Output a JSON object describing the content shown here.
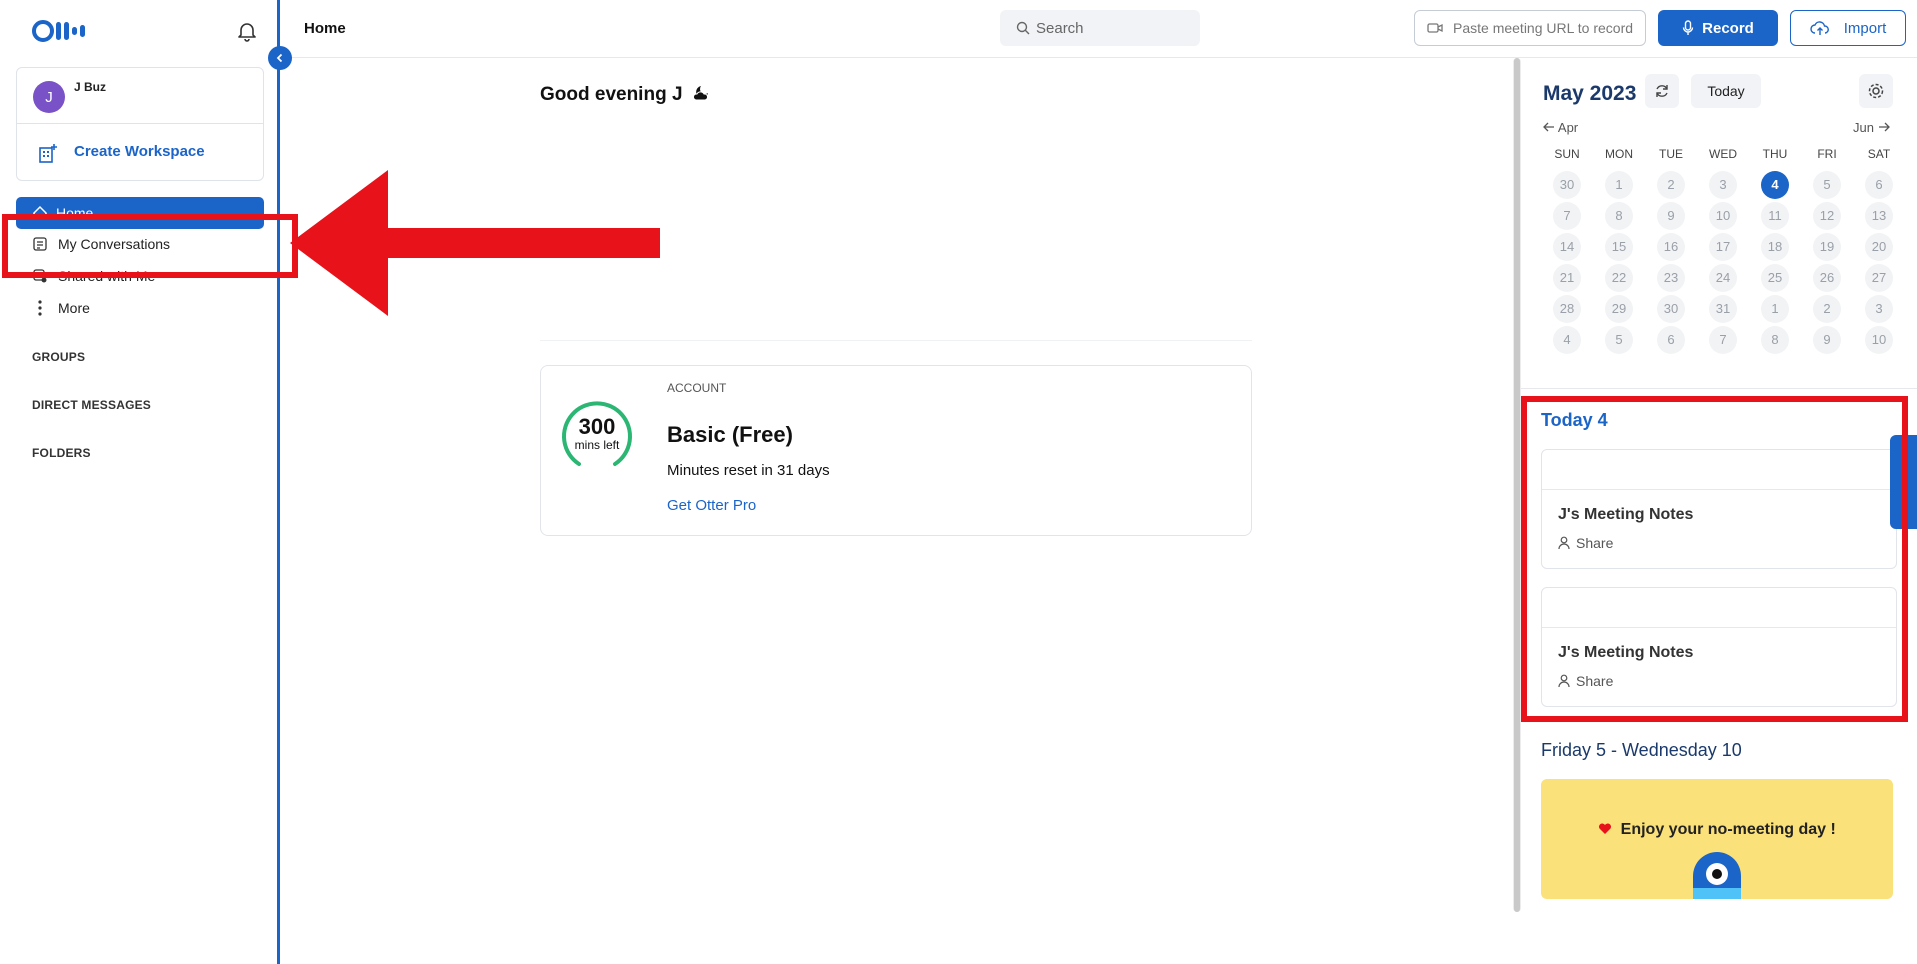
{
  "header": {
    "title": "Home",
    "search_placeholder": "Search",
    "paste_placeholder": "Paste meeting URL to record",
    "record_label": "Record",
    "import_label": "Import"
  },
  "sidebar": {
    "user_initial": "J",
    "user_name": "J Buz",
    "create_workspace": "Create Workspace",
    "nav": {
      "home": "Home",
      "conversations": "My Conversations",
      "shared": "Shared with Me",
      "more": "More"
    },
    "sections": {
      "groups": "GROUPS",
      "direct_messages": "DIRECT MESSAGES",
      "folders": "FOLDERS"
    }
  },
  "main": {
    "greeting": "Good evening J",
    "account": {
      "label": "ACCOUNT",
      "minutes": "300",
      "minutes_sub": "mins left",
      "plan": "Basic (Free)",
      "reset": "Minutes reset in 31 days",
      "upgrade_link": "Get Otter Pro"
    }
  },
  "calendar": {
    "month": "May 2023",
    "today_label": "Today",
    "prev": "Apr",
    "next": "Jun",
    "dow": [
      "SUN",
      "MON",
      "TUE",
      "WED",
      "THU",
      "FRI",
      "SAT"
    ],
    "weeks": [
      [
        "30",
        "1",
        "2",
        "3",
        "4",
        "5",
        "6"
      ],
      [
        "7",
        "8",
        "9",
        "10",
        "11",
        "12",
        "13"
      ],
      [
        "14",
        "15",
        "16",
        "17",
        "18",
        "19",
        "20"
      ],
      [
        "21",
        "22",
        "23",
        "24",
        "25",
        "26",
        "27"
      ],
      [
        "28",
        "29",
        "30",
        "31",
        "1",
        "2",
        "3"
      ],
      [
        "4",
        "5",
        "6",
        "7",
        "8",
        "9",
        "10"
      ]
    ],
    "selected_day": "4"
  },
  "agenda": {
    "today_heading": "Today 4",
    "meetings": [
      {
        "title": "J's Meeting Notes",
        "share": "Share"
      },
      {
        "title": "J's Meeting Notes",
        "share": "Share"
      }
    ],
    "range_heading": "Friday 5 - Wednesday 10",
    "no_meeting": "Enjoy your no-meeting day !"
  },
  "colors": {
    "brand": "#1b64c8",
    "annotation": "#e8121a",
    "no_meeting_bg": "#fbe17a",
    "gauge": "#2bb673"
  }
}
